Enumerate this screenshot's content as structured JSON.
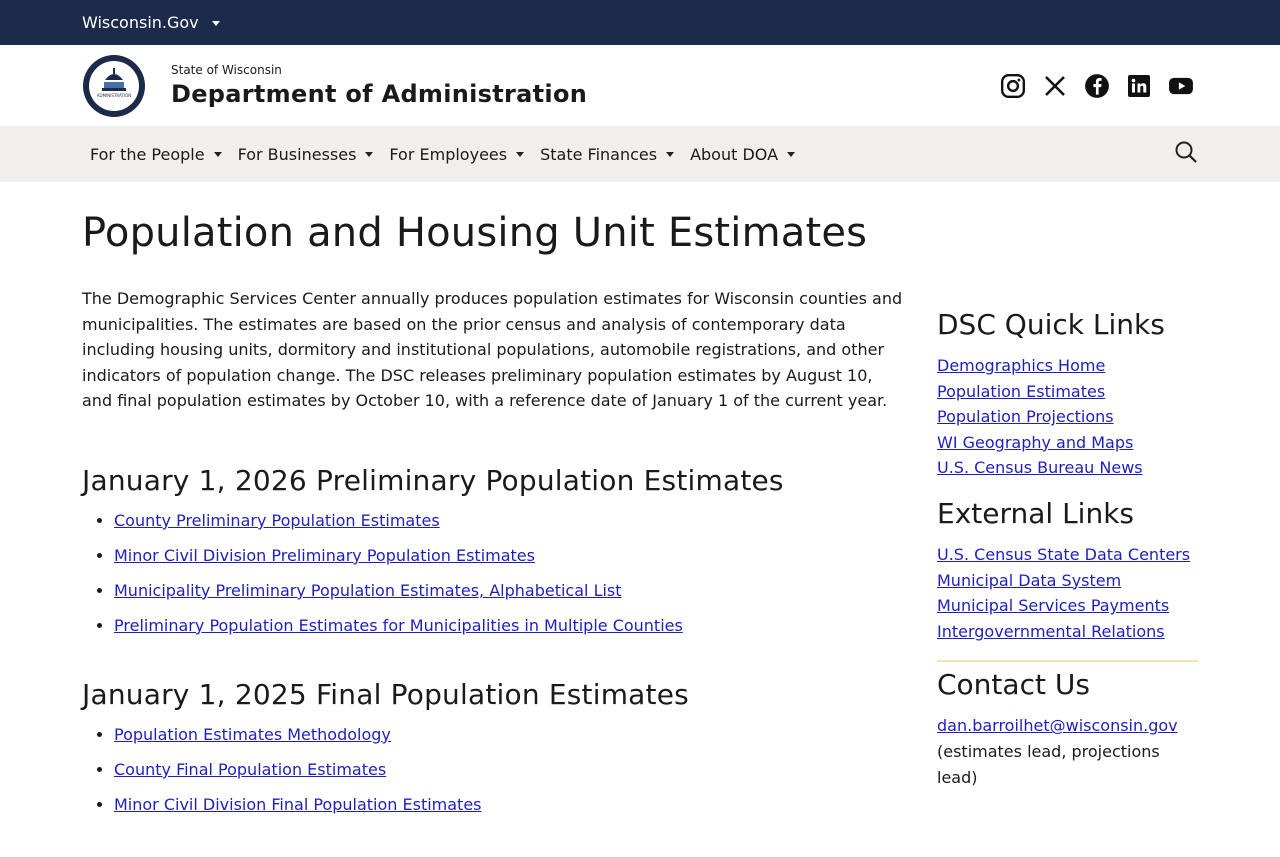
{
  "topbar": {
    "label": "Wisconsin.Gov"
  },
  "header": {
    "state": "State of Wisconsin",
    "department": "Department of Administration",
    "seal_text": "DEPARTMENT OF ADMINISTRATION",
    "social_icons": [
      "instagram-icon",
      "x-icon",
      "facebook-icon",
      "linkedin-icon",
      "youtube-icon"
    ]
  },
  "nav": {
    "items": [
      {
        "label": "For the People"
      },
      {
        "label": "For Businesses"
      },
      {
        "label": "For Employees"
      },
      {
        "label": "State Finances"
      },
      {
        "label": "About DOA"
      }
    ],
    "search_icon": "search-icon"
  },
  "page": {
    "title": "Population and Housing Unit Estimates",
    "intro": "The Demographic Services Center annually produces population estimates for Wisconsin counties and municipalities. The estimates are based on the prior census and analysis of contemporary data including housing units, dormitory and institutional populations, automobile registrations, and other indicators of population change. The DSC releases preliminary population estimates by August 10, and final population estimates by October 10, with a reference date of January 1 of the current year.",
    "sections": [
      {
        "heading": "January 1, 2026 Preliminary Population Estimates",
        "links": [
          "County Preliminary Population Estimates",
          "Minor Civil Division Preliminary Population Estimates",
          "Municipality Preliminary Population Estimates, Alphabetical List",
          "Preliminary Population Estimates for Municipalities in Multiple Counties"
        ]
      },
      {
        "heading": "January 1, 2025 Final Population Estimates",
        "links": [
          "Population Estimates Methodology",
          "County Final Population Estimates",
          "Minor Civil Division Final Population Estimates"
        ]
      }
    ]
  },
  "sidebar": {
    "quick_links": {
      "heading": "DSC Quick Links",
      "links": [
        "Demographics Home",
        "Population Estimates",
        "Population Projections",
        "WI Geography and Maps",
        "U.S. Census Bureau News"
      ]
    },
    "external_links": {
      "heading": "External Links",
      "links": [
        "U.S. Census State Data Centers",
        "Municipal Data System",
        "Municipal Services Payments",
        "Intergovernmental Relations"
      ]
    },
    "contact": {
      "heading": "Contact Us",
      "email": "dan.barroilhet@wisconsin.gov",
      "note": "(estimates lead, projections lead)"
    }
  },
  "colors": {
    "topbar": "#1c2b4a",
    "nav_bg": "#f1efec",
    "link": "#1f1fbf",
    "divider": "#f5e3b3"
  }
}
